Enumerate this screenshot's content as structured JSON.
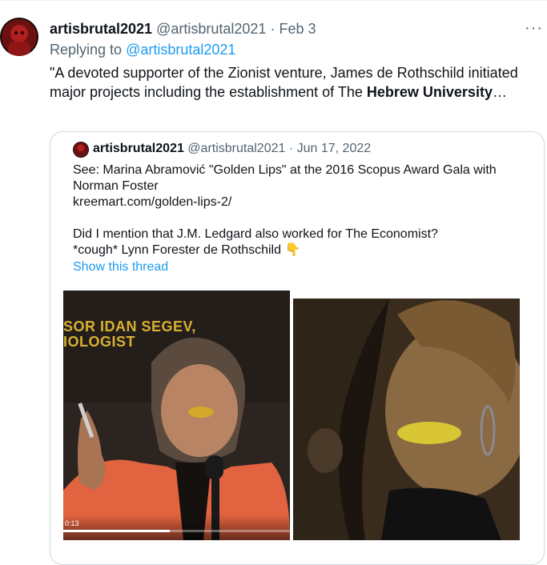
{
  "tweet": {
    "display_name": "artisbrutal2021",
    "handle": "@artisbrutal2021",
    "separator": "·",
    "date": "Feb 3",
    "more_icon": "more-horizontal-icon",
    "more_glyph": "···",
    "replying_prefix": "Replying to",
    "replying_handle": "@artisbrutal2021",
    "text_start": "\"A devoted supporter of the Zionist venture, James de Rothschild initiated major projects including the establishment of The ",
    "text_bold": "Hebrew University",
    "text_end": "…"
  },
  "quote": {
    "display_name": "artisbrutal2021",
    "handle": "@artisbrutal2021",
    "separator": "·",
    "date": "Jun 17, 2022",
    "body": "See: Marina Abramović \"Golden Lips\" at the 2016 Scopus Award Gala with Norman Foster\nkreemart.com/golden-lips-2/\n\nDid I mention that J.M. Ledgard also worked for The Economist?\n*cough* Lynn Forester de Rothschild 👇",
    "show_thread": "Show this thread",
    "media": {
      "left_sign": "SOR IDAN SEGEV,\nIOLOGIST",
      "timestamp": "0:13",
      "progress": 0.47
    }
  },
  "colors": {
    "link": "#1d9bf0",
    "muted": "#536471",
    "text": "#0f1419",
    "border": "#cfd9de"
  }
}
